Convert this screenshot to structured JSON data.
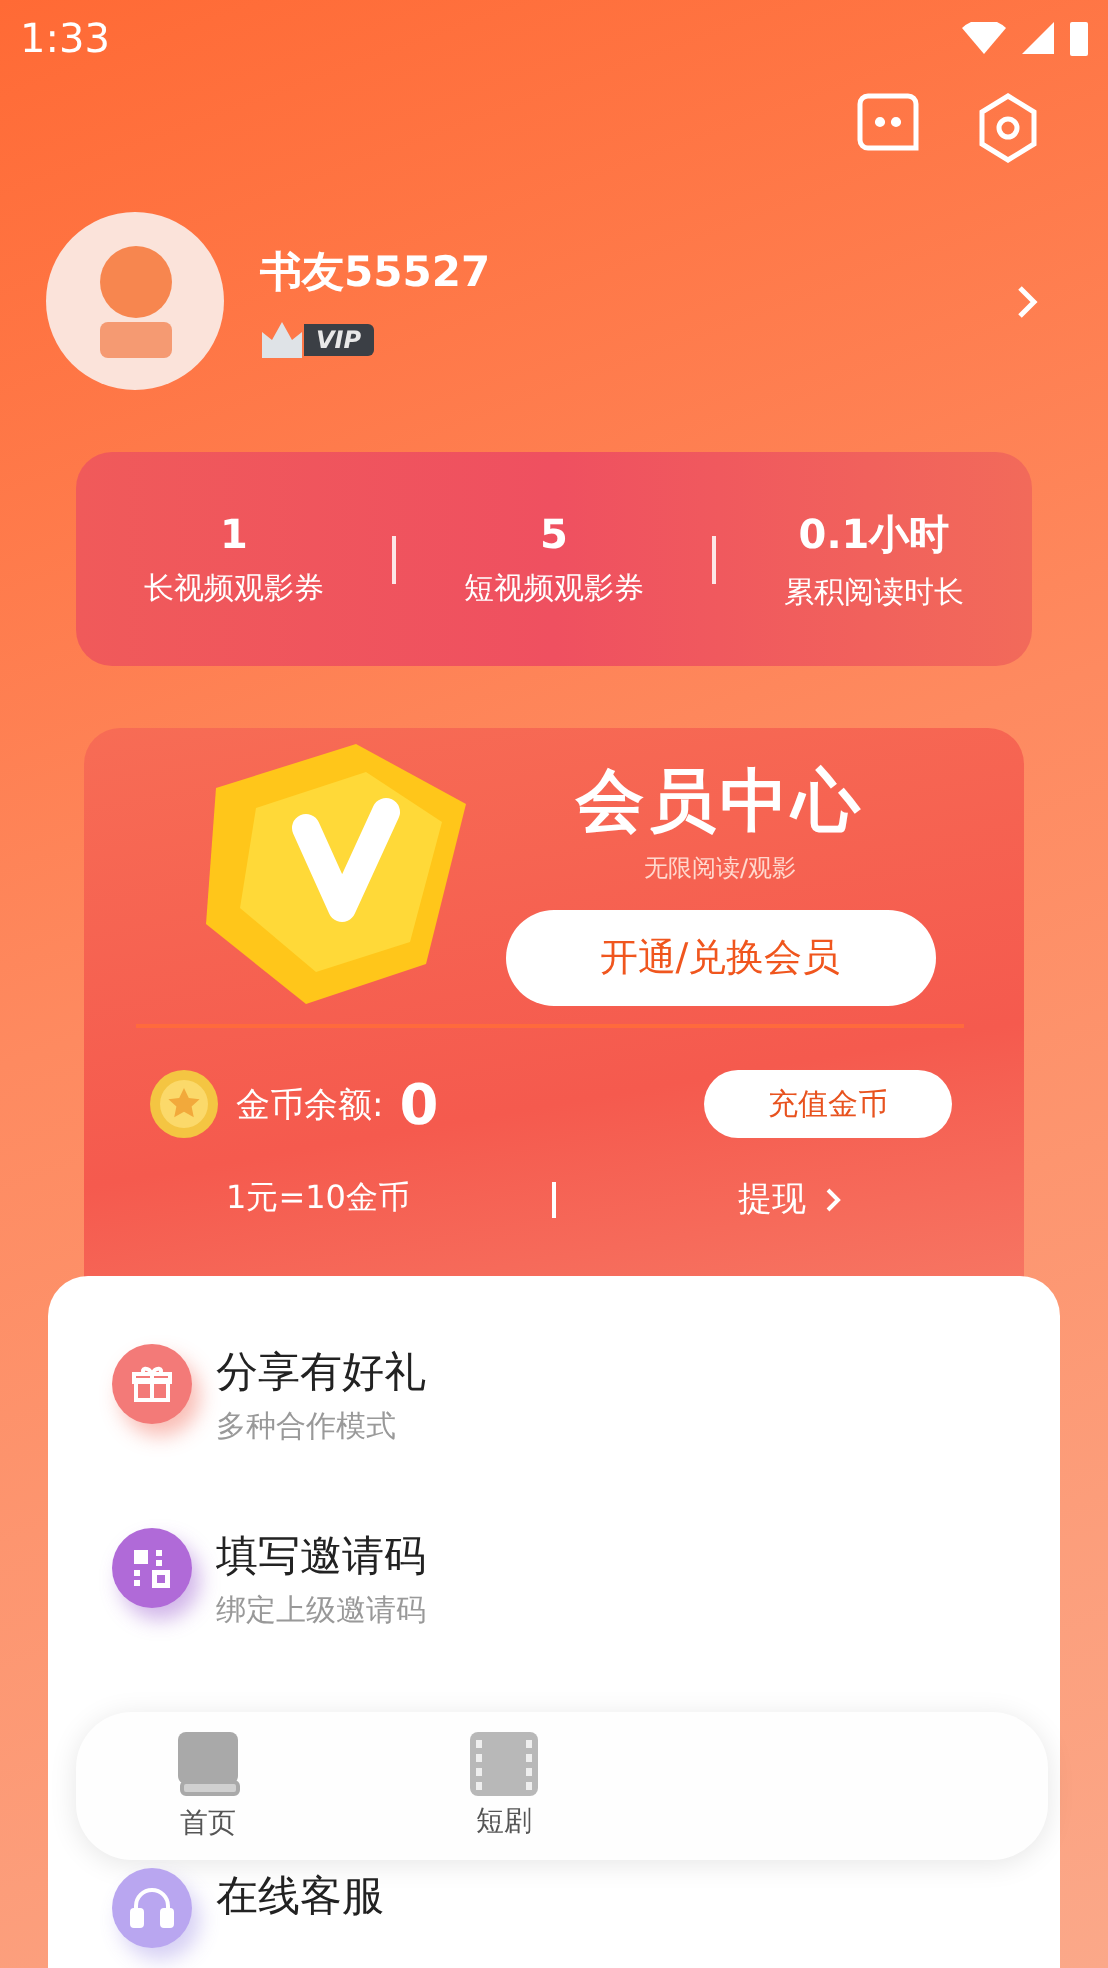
{
  "status_bar": {
    "time": "1:33"
  },
  "profile": {
    "name": "书友55527",
    "badge": "VIP"
  },
  "stats": [
    {
      "value": "1",
      "label": "长视频观影券"
    },
    {
      "value": "5",
      "label": "短视频观影券"
    },
    {
      "value": "0.1小时",
      "label": "累积阅读时长"
    }
  ],
  "member_card": {
    "title": "会员中心",
    "subtitle": "无限阅读/观影",
    "button": "开通/兑换会员",
    "coin_label": "金币余额:",
    "coin_value": "0",
    "recharge_button": "充值金币",
    "rate": "1元=10金币",
    "withdraw": "提现"
  },
  "menu": [
    {
      "kind": "gift",
      "title": "分享有好礼",
      "subtitle": "多种合作模式"
    },
    {
      "kind": "code",
      "title": "填写邀请码",
      "subtitle": "绑定上级邀请码"
    },
    {
      "kind": "service",
      "title": "在线客服"
    }
  ],
  "bottom_nav": [
    {
      "kind": "book",
      "label": "首页",
      "selected": false
    },
    {
      "kind": "film",
      "label": "短剧",
      "selected": false
    }
  ]
}
